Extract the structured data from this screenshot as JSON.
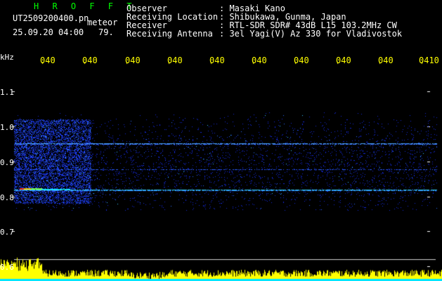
{
  "header": {
    "station": "H R O F F T",
    "filename": "UT2509200400.pn",
    "mode": "meteor",
    "datetime": "25.09.20 04:00",
    "count": "79."
  },
  "info": {
    "labels": [
      "Observer",
      "Receiving Location",
      "Receiver",
      "Receiving Antenna"
    ],
    "values": [
      ": Masaki Kano",
      ": Shibukawa, Gunma, Japan",
      ": RTL-SDR SDR# 43dB L15 103.2MHz CW",
      ": 3el Yagi(V) Az 330 for Vladivostok"
    ]
  },
  "axis": {
    "unit": "kHz",
    "y_ticks": [
      "1.1",
      "1.0",
      "0.9",
      "0.8",
      "0.7",
      "0.6"
    ],
    "time_ticks": [
      "040",
      "040",
      "040",
      "040",
      "040",
      "040",
      "040",
      "040",
      "040",
      "0410"
    ]
  },
  "colors": {
    "background": "#000000",
    "signal_low": "#1a2cff",
    "signal_mid": "#00ffff",
    "signal_high": "#ff3300",
    "activity_bar": "#ffff00",
    "activity_base": "#00e5ff",
    "axis_text": "#ffff00"
  }
}
